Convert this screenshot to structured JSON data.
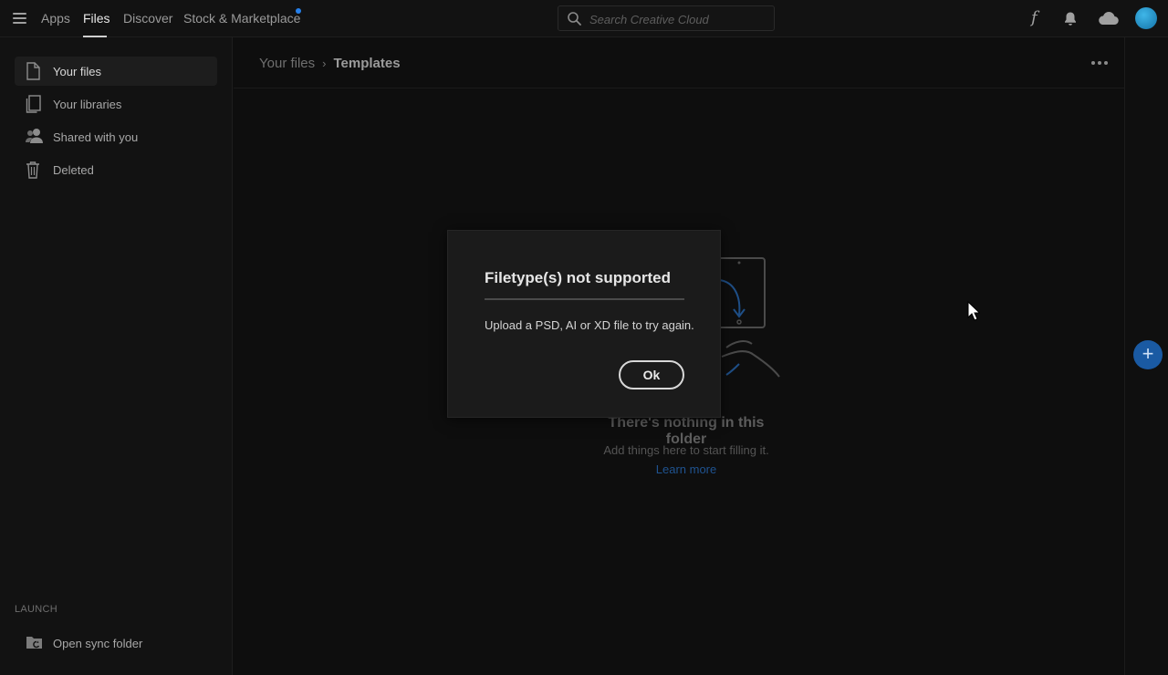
{
  "nav": {
    "items": [
      {
        "label": "Apps",
        "active": false
      },
      {
        "label": "Files",
        "active": true
      },
      {
        "label": "Discover",
        "active": false
      },
      {
        "label": "Stock & Marketplace",
        "active": false
      }
    ]
  },
  "search": {
    "placeholder": "Search Creative Cloud",
    "value": ""
  },
  "topbar_icons": [
    "fonts-icon",
    "bell-icon",
    "cloud-icon",
    "avatar"
  ],
  "sidebar": {
    "items": [
      {
        "label": "Your files",
        "icon": "file-icon",
        "selected": true
      },
      {
        "label": "Your libraries",
        "icon": "libraries-icon",
        "selected": false
      },
      {
        "label": "Shared with you",
        "icon": "shared-users-icon",
        "selected": false
      },
      {
        "label": "Deleted",
        "icon": "trash-icon",
        "selected": false
      }
    ],
    "launch_label": "LAUNCH",
    "launch_items": [
      {
        "label": "Open sync folder",
        "icon": "sync-folder-icon"
      }
    ]
  },
  "breadcrumb": {
    "parent": "Your files",
    "current": "Templates"
  },
  "empty_state": {
    "title": "There's nothing in this folder",
    "subtitle": "Add things here to start filling it.",
    "link": "Learn more"
  },
  "dialog": {
    "title": "Filetype(s) not supported",
    "message": "Upload a PSD, AI or XD file to try again.",
    "ok_label": "Ok"
  },
  "colors": {
    "accent": "#2680eb",
    "fab": "#1a5aa3",
    "link": "#1f5390"
  }
}
